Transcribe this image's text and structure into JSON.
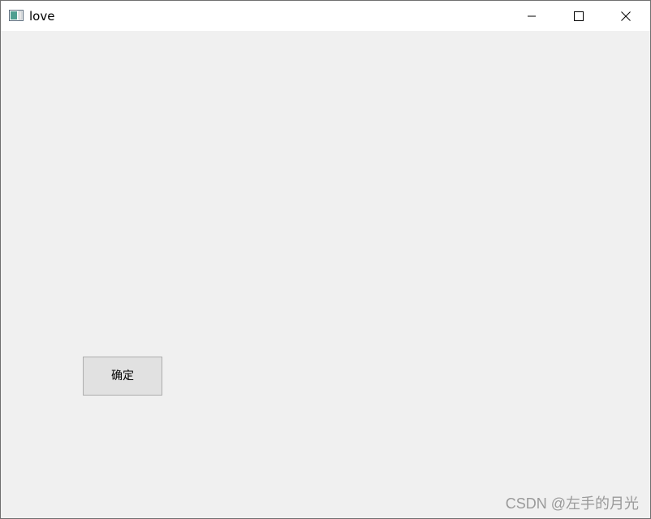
{
  "window": {
    "title": "love",
    "app_icon": "window-app-icon",
    "controls": {
      "minimize_icon": "minimize-icon",
      "maximize_icon": "maximize-icon",
      "close_icon": "close-icon"
    }
  },
  "content": {
    "ok_button_label": "确定",
    "watermark": "CSDN @左手的月光"
  },
  "colors": {
    "titlebar_bg": "#ffffff",
    "content_bg": "#f0f0f0",
    "button_bg": "#e1e1e1",
    "button_border": "#adadad",
    "watermark_text": "#9a9a9a"
  }
}
